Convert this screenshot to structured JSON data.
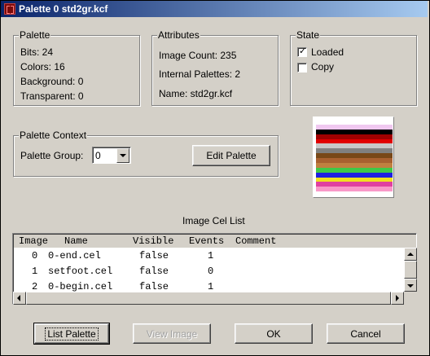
{
  "window": {
    "title": "Palette 0 std2gr.kcf",
    "icon": "app-icon"
  },
  "palette": {
    "legend": "Palette",
    "bits": "Bits:  24",
    "colors": "Colors:  16",
    "background": "Background:  0",
    "transparent": "Transparent:  0"
  },
  "attributes": {
    "legend": "Attributes",
    "image_count": "Image Count:  235",
    "internal_palettes": "Internal Palettes:  2",
    "name": "Name:  std2gr.kcf"
  },
  "state": {
    "legend": "State",
    "loaded_label": "Loaded",
    "loaded_checked": true,
    "copy_label": "Copy",
    "copy_checked": false
  },
  "context": {
    "legend": "Palette Context",
    "group_label": "Palette Group:",
    "group_value": "0",
    "edit_button": "Edit Palette"
  },
  "swatch_colors": [
    "#ffffff",
    "#f0c8f0",
    "#000000",
    "#a00000",
    "#e00000",
    "#c8c8c8",
    "#808080",
    "#784818",
    "#a86030",
    "#c08040",
    "#40c848",
    "#2020e0",
    "#f0e020",
    "#e040a0",
    "#f898c8",
    "#ffffff"
  ],
  "cel_list": {
    "title": "Image Cel List",
    "headers": [
      "Image",
      "Name",
      "Visible",
      "Events",
      "Comment"
    ],
    "rows": [
      {
        "image": "0",
        "name": "0-end.cel",
        "visible": "false",
        "events": "1",
        "comment": ""
      },
      {
        "image": "1",
        "name": "setfoot.cel",
        "visible": "false",
        "events": "0",
        "comment": ""
      },
      {
        "image": "2",
        "name": "0-begin.cel",
        "visible": "false",
        "events": "1",
        "comment": ""
      }
    ]
  },
  "buttons": {
    "list_palette": "List Palette",
    "view_image": "View Image",
    "ok": "OK",
    "cancel": "Cancel"
  }
}
